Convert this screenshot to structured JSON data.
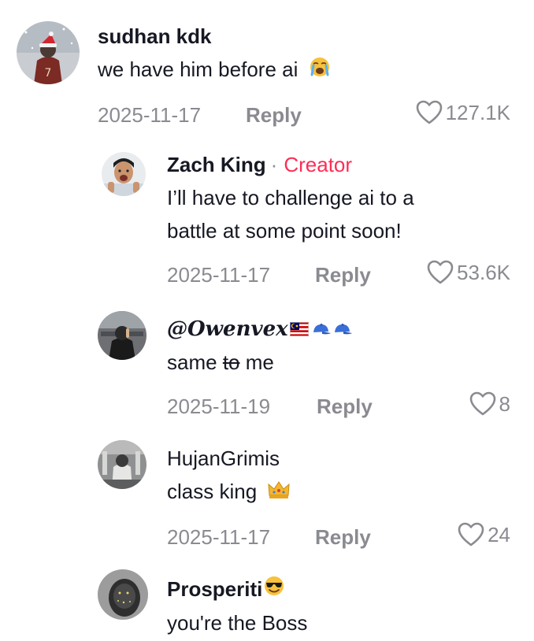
{
  "colors": {
    "text": "#161823",
    "secondary": "#8a8b91",
    "creator": "#fe2c55"
  },
  "comments": [
    {
      "username": "sudhan kdk",
      "text": "we have him before ai",
      "emoji": "loudly-crying-face",
      "date": "2025-11-17",
      "reply_label": "Reply",
      "likes": "127.1K"
    },
    {
      "username": "Zach King",
      "separator": "·",
      "badge": "Creator",
      "text": "I’ll have to challenge ai to a battle at some point soon!",
      "date": "2025-11-17",
      "reply_label": "Reply",
      "likes": "53.6K"
    },
    {
      "username": "@𝑶𝒘𝒆𝒏𝒗𝒆𝒙",
      "username_emoji": [
        "malaysia-flag",
        "blue-cap",
        "blue-cap"
      ],
      "text_a": "same ",
      "text_b": "to",
      "text_c": " me",
      "date": "2025-11-19",
      "reply_label": "Reply",
      "likes": "8"
    },
    {
      "username": "HujanGrimis",
      "text": "class king",
      "emoji": "crown",
      "date": "2025-11-17",
      "reply_label": "Reply",
      "likes": "24"
    },
    {
      "username": "Prosperiti",
      "username_emoji": [
        "smiling-face-with-sunglasses"
      ],
      "text": "you're the Boss"
    }
  ]
}
